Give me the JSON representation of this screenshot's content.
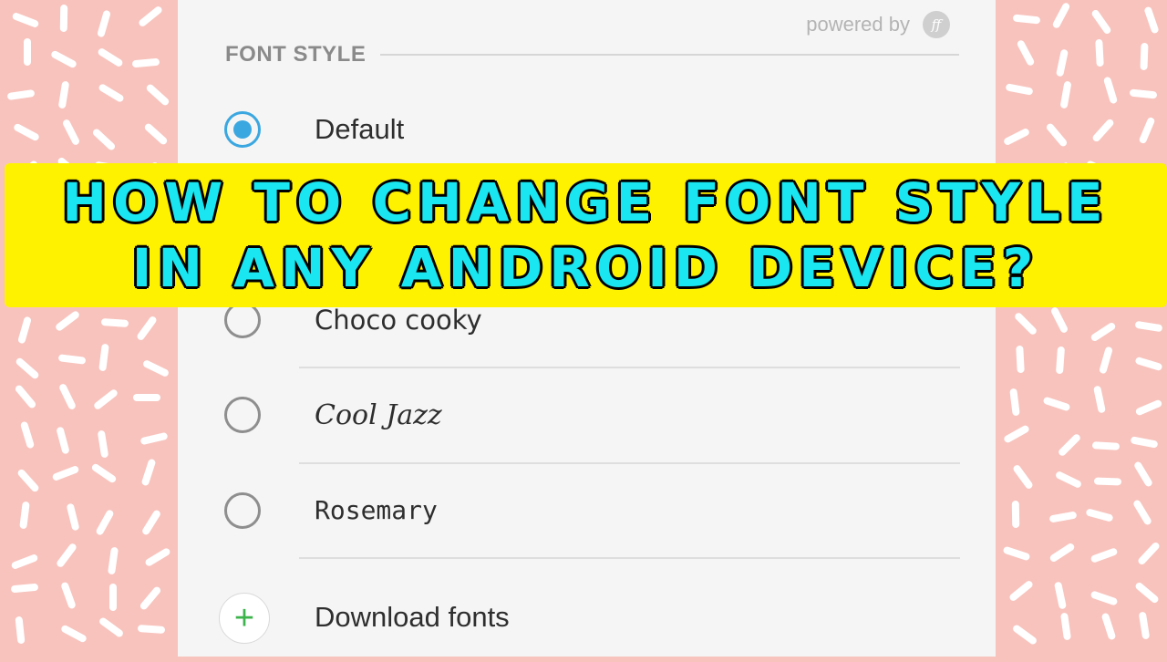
{
  "powered_by": "powered by",
  "logo_text": "ff",
  "section_title": "FONT STYLE",
  "options": [
    {
      "label": "Default",
      "selected": true
    },
    {
      "label": "Choco cooky",
      "selected": false
    },
    {
      "label": "Cool Jazz",
      "selected": false
    },
    {
      "label": "Rosemary",
      "selected": false
    }
  ],
  "download_label": "Download fonts",
  "banner": {
    "line1": "HOW TO CHANGE FONT STYLE",
    "line2": "IN ANY ANDROID DEVICE?"
  },
  "colors": {
    "background": "#f8c3bd",
    "accent": "#3ba7e0",
    "banner_bg": "#fff200",
    "banner_text": "#19e6f0",
    "plus_icon": "#3cb44b"
  }
}
